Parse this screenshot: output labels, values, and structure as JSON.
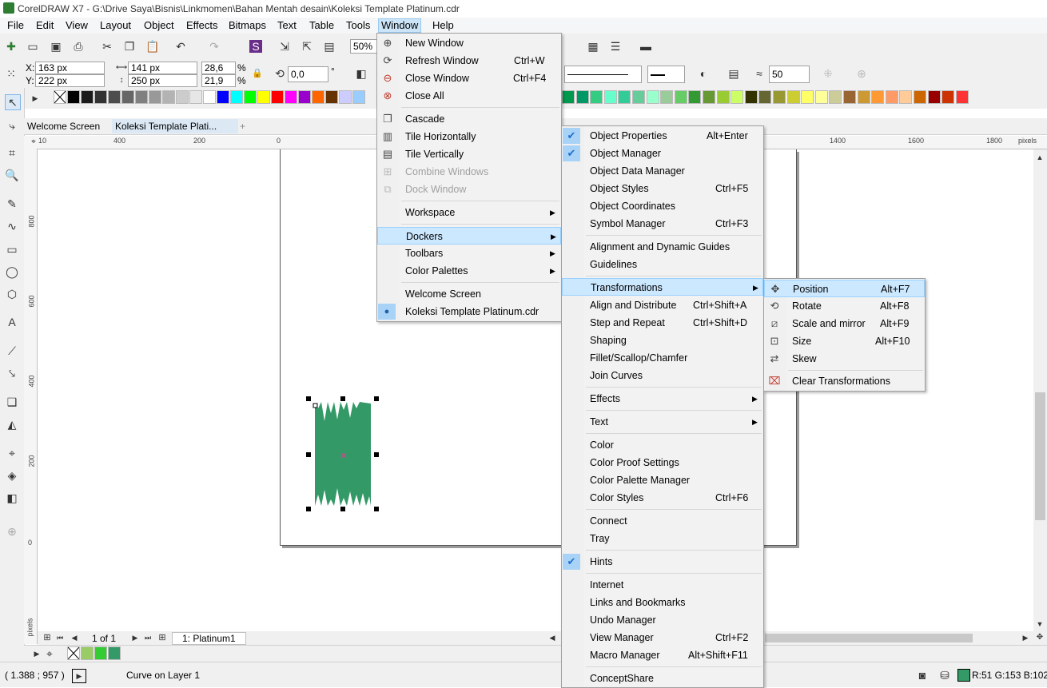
{
  "app": {
    "title": "CorelDRAW X7 - G:\\Drive Saya\\Bisnis\\Linkmomen\\Bahan Mentah desain\\Koleksi Template Platinum.cdr"
  },
  "menubar": [
    "File",
    "Edit",
    "View",
    "Layout",
    "Object",
    "Effects",
    "Bitmaps",
    "Text",
    "Table",
    "Tools",
    "Window",
    "Help"
  ],
  "toolbar": {
    "zoom": "50%"
  },
  "propbar": {
    "x": "163 px",
    "y": "222 px",
    "w": "141 px",
    "h": "250 px",
    "sx": "28,6",
    "sy": "21,9",
    "pct1": "%",
    "pct2": "%",
    "rotation": "0,0",
    "deg": "°",
    "x_label": "X:",
    "y_label": "Y:",
    "smooth": "50"
  },
  "tabs": {
    "welcome": "Welcome Screen",
    "doc": "Koleksi Template Plati..."
  },
  "ruler": {
    "h_ticks": [
      "400",
      "200",
      "0",
      "1400",
      "1600",
      "1800",
      "pixels"
    ],
    "v_ticks": [
      "800",
      "600",
      "400",
      "200",
      "0",
      "pixels"
    ],
    "h_first": "10"
  },
  "pagenav": {
    "page_of": "1 of 1",
    "page_tab": "1: Platinum1"
  },
  "status": {
    "coords": "( 1.388 ; 957  )",
    "info": "Curve on Layer 1",
    "color": "R:51 G:153 B:102 ("
  },
  "palette_colors": [
    "#000000",
    "#1a1a1a",
    "#333333",
    "#4d4d4d",
    "#666666",
    "#808080",
    "#999999",
    "#b3b3b3",
    "#cccccc",
    "#e6e6e6",
    "#ffffff",
    "#0000ff",
    "#00ffff",
    "#00ff00",
    "#ffff00",
    "#ff0000",
    "#ff00ff",
    "#9900cc",
    "#ff6600",
    "#663300",
    "#ccccff",
    "#99ccff"
  ],
  "palette_colors2": [
    "#8b1a4a",
    "#b03060",
    "#d63c78",
    "#ff1a8c",
    "#ff6699",
    "#cc6699",
    "#990066",
    "#cc3399",
    "#663366",
    "#996699",
    "#9966cc",
    "#663399",
    "#330066",
    "#6666cc",
    "#9999ff",
    "#cc99ff"
  ],
  "palette_colors_right": [
    "#00994d",
    "#009966",
    "#33cc80",
    "#66ffcc",
    "#33cc99",
    "#66cc99",
    "#99ffcc",
    "#99cc99",
    "#66cc66",
    "#339933",
    "#669933",
    "#99cc33",
    "#ccff66",
    "#333300",
    "#666633",
    "#999933",
    "#cccc33",
    "#ffff66",
    "#ffff99",
    "#cccc99",
    "#996633",
    "#cc9933",
    "#ff9933",
    "#ff9966",
    "#ffcc99",
    "#cc6600",
    "#990000",
    "#cc3300",
    "#ff3333"
  ],
  "doc_palette": [
    "#99cc66",
    "#33cc33",
    "#339966"
  ],
  "window_menu": [
    {
      "label": "New Window",
      "shortcut": "",
      "icon": "new-window-icon"
    },
    {
      "label": "Refresh Window",
      "shortcut": "Ctrl+W",
      "icon": "refresh-window-icon"
    },
    {
      "label": "Close Window",
      "shortcut": "Ctrl+F4",
      "icon": "close-window-icon"
    },
    {
      "label": "Close All",
      "shortcut": "",
      "icon": "close-all-icon"
    },
    {
      "label": "Cascade",
      "shortcut": "",
      "icon": "cascade-icon"
    },
    {
      "label": "Tile Horizontally",
      "shortcut": "",
      "icon": "tile-horizontal-icon"
    },
    {
      "label": "Tile Vertically",
      "shortcut": "",
      "icon": "tile-vertical-icon"
    },
    {
      "label": "Combine Windows",
      "shortcut": "",
      "icon": "combine-windows-icon"
    },
    {
      "label": "Dock Window",
      "shortcut": "",
      "icon": "dock-window-icon"
    },
    {
      "label": "Workspace",
      "shortcut": "",
      "icon": ""
    },
    {
      "label": "Dockers",
      "shortcut": "",
      "icon": ""
    },
    {
      "label": "Toolbars",
      "shortcut": "",
      "icon": ""
    },
    {
      "label": "Color Palettes",
      "shortcut": "",
      "icon": ""
    },
    {
      "label": "Welcome Screen",
      "shortcut": "",
      "icon": ""
    },
    {
      "label": "Koleksi Template Platinum.cdr",
      "shortcut": "",
      "icon": ""
    }
  ],
  "dockers_menu": [
    {
      "label": "Object Properties",
      "shortcut": "Alt+Enter"
    },
    {
      "label": "Object Manager",
      "shortcut": ""
    },
    {
      "label": "Object Data Manager",
      "shortcut": ""
    },
    {
      "label": "Object Styles",
      "shortcut": "Ctrl+F5"
    },
    {
      "label": "Object Coordinates",
      "shortcut": ""
    },
    {
      "label": "Symbol Manager",
      "shortcut": "Ctrl+F3"
    },
    {
      "label": "Alignment and Dynamic Guides",
      "shortcut": ""
    },
    {
      "label": "Guidelines",
      "shortcut": ""
    },
    {
      "label": "Transformations",
      "shortcut": ""
    },
    {
      "label": "Align and Distribute",
      "shortcut": "Ctrl+Shift+A"
    },
    {
      "label": "Step and Repeat",
      "shortcut": "Ctrl+Shift+D"
    },
    {
      "label": "Shaping",
      "shortcut": ""
    },
    {
      "label": "Fillet/Scallop/Chamfer",
      "shortcut": ""
    },
    {
      "label": "Join Curves",
      "shortcut": ""
    },
    {
      "label": "Effects",
      "shortcut": ""
    },
    {
      "label": "Text",
      "shortcut": ""
    },
    {
      "label": "Color",
      "shortcut": ""
    },
    {
      "label": "Color Proof Settings",
      "shortcut": ""
    },
    {
      "label": "Color Palette Manager",
      "shortcut": ""
    },
    {
      "label": "Color Styles",
      "shortcut": "Ctrl+F6"
    },
    {
      "label": "Connect",
      "shortcut": ""
    },
    {
      "label": "Tray",
      "shortcut": ""
    },
    {
      "label": "Hints",
      "shortcut": ""
    },
    {
      "label": "Internet",
      "shortcut": ""
    },
    {
      "label": "Links and Bookmarks",
      "shortcut": ""
    },
    {
      "label": "Undo Manager",
      "shortcut": ""
    },
    {
      "label": "View Manager",
      "shortcut": "Ctrl+F2"
    },
    {
      "label": "Macro Manager",
      "shortcut": "Alt+Shift+F11"
    },
    {
      "label": "ConceptShare",
      "shortcut": ""
    }
  ],
  "transform_menu": [
    {
      "label": "Position",
      "shortcut": "Alt+F7",
      "icon": "move-icon"
    },
    {
      "label": "Rotate",
      "shortcut": "Alt+F8",
      "icon": "rotate-icon"
    },
    {
      "label": "Scale and mirror",
      "shortcut": "Alt+F9",
      "icon": "scale-mirror-icon"
    },
    {
      "label": "Size",
      "shortcut": "Alt+F10",
      "icon": "size-icon"
    },
    {
      "label": "Skew",
      "shortcut": "",
      "icon": "skew-icon"
    },
    {
      "label": "Clear Transformations",
      "shortcut": "",
      "icon": "clear-transform-icon"
    }
  ],
  "shape": {
    "fill": "#339966"
  }
}
